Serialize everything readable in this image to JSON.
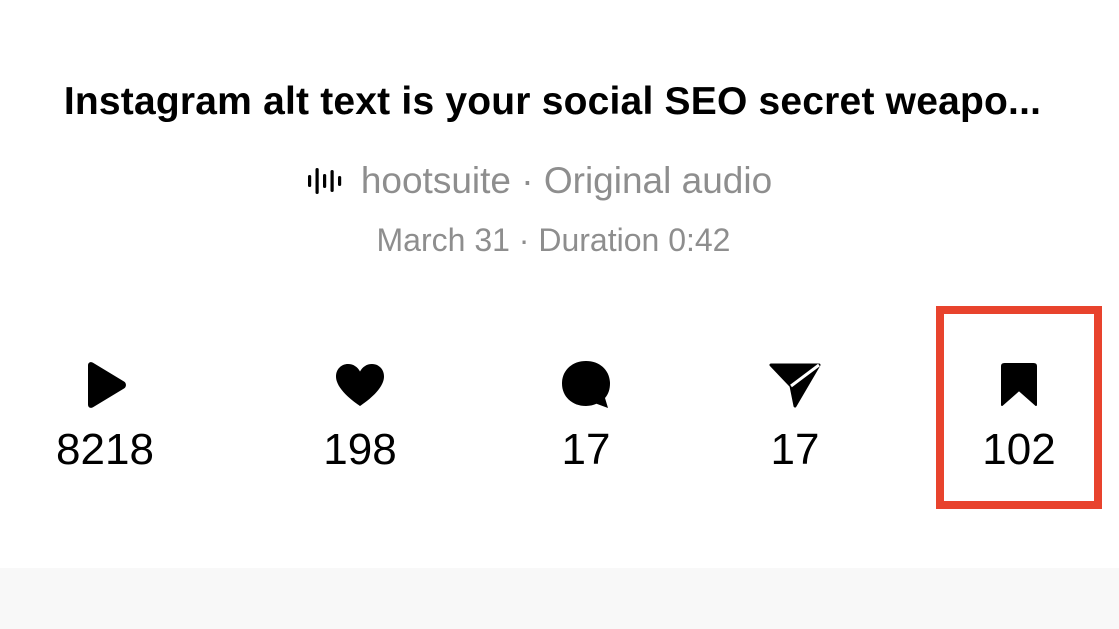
{
  "post": {
    "title": "Instagram alt text is your social SEO secret weapo...",
    "audio": {
      "icon": "audio-waveform-icon",
      "text": "hootsuite · Original audio"
    },
    "meta": "March 31 · Duration 0:42"
  },
  "stats": [
    {
      "icon": "play-icon",
      "count": "8218"
    },
    {
      "icon": "heart-icon",
      "count": "198"
    },
    {
      "icon": "comment-icon",
      "count": "17"
    },
    {
      "icon": "share-icon",
      "count": "17"
    },
    {
      "icon": "bookmark-icon",
      "count": "102"
    }
  ],
  "highlight_color": "#e8432d"
}
